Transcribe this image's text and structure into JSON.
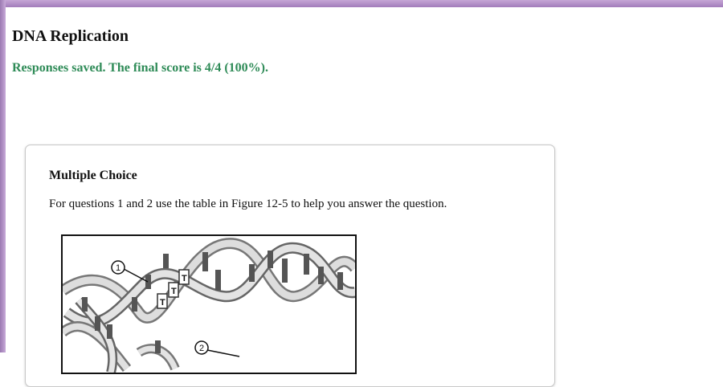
{
  "page": {
    "title": "DNA Replication",
    "status_message": "Responses saved. The final score is 4/4 (100%).",
    "status_color": "#2e8b57"
  },
  "card": {
    "heading": "Multiple Choice",
    "instructions": "For questions 1 and 2 use the table in Figure 12-5 to help you answer the question."
  },
  "figure": {
    "callout_1": "1",
    "callout_2": "2",
    "icon": "dna-double-helix-illustration"
  }
}
